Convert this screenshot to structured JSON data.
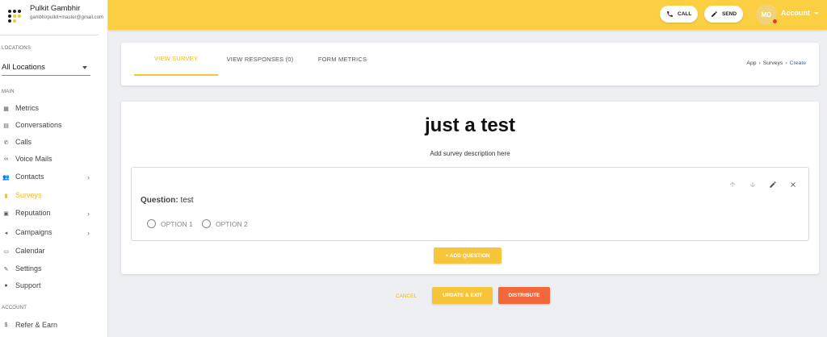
{
  "user": {
    "name": "Pulkit Gambhir",
    "email": "gambhirpulkit+master@gmail.com"
  },
  "sidebar": {
    "locations_label": "LOCATIONS",
    "location_value": "All Locations",
    "main_label": "MAIN",
    "items": [
      {
        "label": "Metrics",
        "icon": "metrics-icon",
        "chevron": false,
        "active": false
      },
      {
        "label": "Conversations",
        "icon": "chat-icon",
        "chevron": false,
        "active": false
      },
      {
        "label": "Calls",
        "icon": "phone-icon",
        "chevron": false,
        "active": false
      },
      {
        "label": "Voice Mails",
        "icon": "voicemail-icon",
        "chevron": false,
        "active": false
      },
      {
        "label": "Contacts",
        "icon": "people-icon",
        "chevron": true,
        "active": false
      },
      {
        "label": "Surveys",
        "icon": "survey-icon",
        "chevron": false,
        "active": true
      },
      {
        "label": "Reputation",
        "icon": "reputation-icon",
        "chevron": true,
        "active": false
      },
      {
        "label": "Campaigns",
        "icon": "megaphone-icon",
        "chevron": true,
        "active": false
      },
      {
        "label": "Calendar",
        "icon": "calendar-icon",
        "chevron": false,
        "active": false
      },
      {
        "label": "Settings",
        "icon": "wrench-icon",
        "chevron": false,
        "active": false
      },
      {
        "label": "Support",
        "icon": "help-icon",
        "chevron": false,
        "active": false
      }
    ],
    "account_label": "ACCOUNT",
    "account_items": [
      {
        "label": "Refer & Earn",
        "icon": "dollar-icon"
      }
    ]
  },
  "topbar": {
    "call_label": "CALL",
    "send_label": "SEND",
    "avatar_initials": "MD",
    "account_label": "Account",
    "accent": "#fccf43"
  },
  "tabs": {
    "items": [
      "VIEW SURVEY",
      "VIEW RESPONSES (0)",
      "FORM METRICS"
    ],
    "active_index": 0
  },
  "breadcrumb": {
    "items": [
      "App",
      "Surveys",
      "Create"
    ]
  },
  "survey": {
    "title": "just a test",
    "description": "Add survey description here",
    "question_prefix": "Question:",
    "question_text": "test",
    "options": [
      "OPTION 1",
      "OPTION 2"
    ],
    "add_question_label": "+ ADD QUESTION"
  },
  "footer": {
    "cancel_label": "CANCEL",
    "update_label": "UPDATE & EXIT",
    "distribute_label": "DISTRIBUTE",
    "distribute_color": "#f2683b"
  }
}
